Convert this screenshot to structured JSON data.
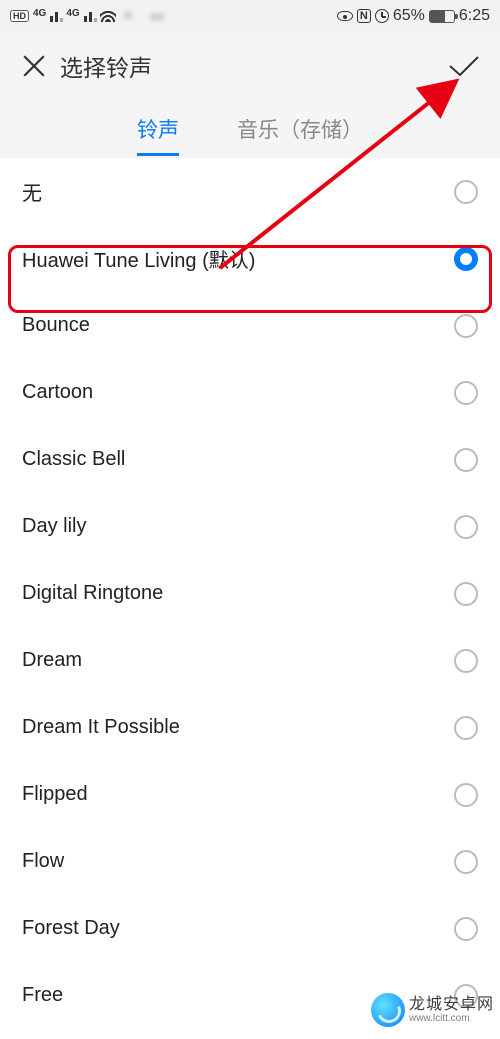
{
  "status": {
    "battery_pct": "65%",
    "time": "6:25"
  },
  "header": {
    "title": "选择铃声"
  },
  "tabs": {
    "ringtone": "铃声",
    "music": "音乐（存储）",
    "active": 0
  },
  "list": {
    "items": [
      {
        "label": "无",
        "selected": false
      },
      {
        "label": "Huawei Tune Living (默认)",
        "selected": true
      },
      {
        "label": "Bounce",
        "selected": false
      },
      {
        "label": "Cartoon",
        "selected": false
      },
      {
        "label": "Classic Bell",
        "selected": false
      },
      {
        "label": "Day lily",
        "selected": false
      },
      {
        "label": "Digital Ringtone",
        "selected": false
      },
      {
        "label": "Dream",
        "selected": false
      },
      {
        "label": "Dream It Possible",
        "selected": false
      },
      {
        "label": "Flipped",
        "selected": false
      },
      {
        "label": "Flow",
        "selected": false
      },
      {
        "label": "Forest Day",
        "selected": false
      },
      {
        "label": "Free",
        "selected": false
      }
    ]
  },
  "watermark": {
    "name": "龙城安卓网",
    "url": "www.lcitt.com"
  }
}
